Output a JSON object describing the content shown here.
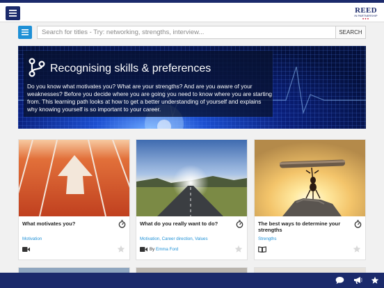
{
  "header": {
    "menu_icon": "hamburger-menu-icon",
    "logo": {
      "line1": "REED",
      "line2": "IN PARTNERSHIP",
      "dots": "●●●"
    },
    "colors": {
      "brand_navy": "#1b2a6b",
      "accent_blue": "#1e90d6",
      "logo_red": "#c8102e"
    }
  },
  "search": {
    "filter_icon": "list-filter-icon",
    "placeholder": "Search for titles - Try: networking, strengths, interview...",
    "value": "",
    "button_label": "SEARCH"
  },
  "hero": {
    "icon": "branch-path-icon",
    "title": "Recognising skills & preferences",
    "description": "Do you know what motivates you? What are your strengths? And are you aware of your weaknesses? Before you decide where you are going you need to know where you are starting from. This learning path looks at how to get a better understanding of yourself and explains why knowing yourself is so important to your career."
  },
  "cards": [
    {
      "title": "What motivates you?",
      "tags": "Motivation",
      "type_icon": "video-camera-icon",
      "author_prefix": "",
      "author": "",
      "image": "running-track-arrow"
    },
    {
      "title": "What do you really want to do?",
      "tags": "Motivation, Career direction, Values",
      "type_icon": "video-camera-icon",
      "author_prefix": "By",
      "author": "Emma Ford",
      "image": "road-to-horizon"
    },
    {
      "title": "The best ways to determine your strengths",
      "tags": "Strengths",
      "type_icon": "open-book-icon",
      "author_prefix": "",
      "author": "",
      "image": "ant-lifting-log"
    }
  ],
  "footer": {
    "icons": [
      "chat-bubble-icon",
      "megaphone-icon",
      "star-icon"
    ]
  }
}
